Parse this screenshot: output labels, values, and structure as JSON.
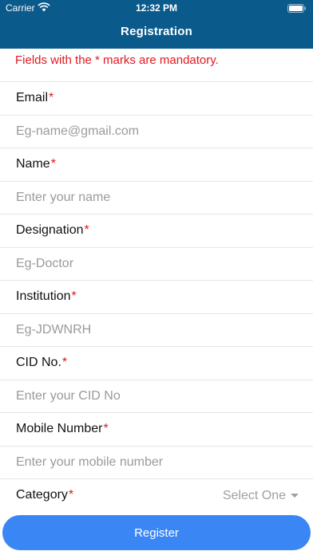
{
  "status_bar": {
    "carrier": "Carrier",
    "time": "12:32 PM"
  },
  "nav": {
    "title": "Registration"
  },
  "notice": "Fields with the * marks are mandatory.",
  "fields": [
    {
      "label": "Email",
      "required_mark": "*",
      "placeholder": "Eg-name@gmail.com"
    },
    {
      "label": "Name",
      "required_mark": "*",
      "placeholder": "Enter your name"
    },
    {
      "label": "Designation",
      "required_mark": "*",
      "placeholder": "Eg-Doctor"
    },
    {
      "label": "Institution",
      "required_mark": "*",
      "placeholder": "Eg-JDWNRH"
    },
    {
      "label": "CID No.",
      "required_mark": "*",
      "placeholder": "Enter your CID No"
    },
    {
      "label": "Mobile Number",
      "required_mark": "*",
      "placeholder": "Enter your mobile number"
    }
  ],
  "category": {
    "label": "Category",
    "required_mark": "*",
    "selected": "Select One"
  },
  "register_button": "Register"
}
